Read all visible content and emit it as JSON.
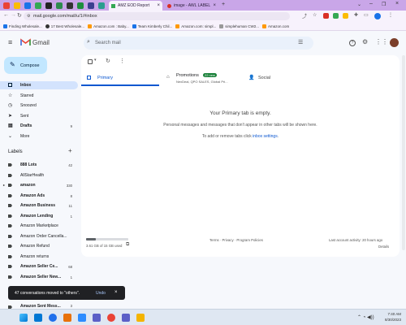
{
  "browser": {
    "tabs": [
      {
        "label": "AMZ EOD Report"
      },
      {
        "label": "image - AWL LABEL"
      }
    ],
    "address": "mail.google.com/mail/u/1/#inbox",
    "bookmarks": [
      {
        "label": "Finding Wholesale..."
      },
      {
        "label": "17 Best Wholesale..."
      },
      {
        "label": "Amazon.com : Baby..."
      },
      {
        "label": "Team Kimberly Chil..."
      },
      {
        "label": "Amazon.com: simpl..."
      },
      {
        "label": "simplehuman CW2..."
      },
      {
        "label": "Amazon.com"
      }
    ]
  },
  "gmail": {
    "logo_text": "Gmail",
    "search_placeholder": "Search mail",
    "compose_label": "Compose",
    "nav": [
      {
        "label": "Inbox",
        "count": ""
      },
      {
        "label": "Starred",
        "count": ""
      },
      {
        "label": "Snoozed",
        "count": ""
      },
      {
        "label": "Sent",
        "count": ""
      },
      {
        "label": "Drafts",
        "count": "9"
      },
      {
        "label": "More",
        "count": ""
      }
    ],
    "labels_heading": "Labels",
    "labels": [
      {
        "label": "888 Lots",
        "count": "42",
        "bold": true
      },
      {
        "label": "AllStarHealth",
        "count": "",
        "bold": false
      },
      {
        "label": "amazon",
        "count": "330",
        "bold": true
      },
      {
        "label": "Amazon Ads",
        "count": "8",
        "bold": true
      },
      {
        "label": "Amazon Business",
        "count": "11",
        "bold": true
      },
      {
        "label": "Amazon Lending",
        "count": "1",
        "bold": true
      },
      {
        "label": "Amazon Marketplace",
        "count": "",
        "bold": false
      },
      {
        "label": "Amazon Order Cancella...",
        "count": "",
        "bold": false
      },
      {
        "label": "Amazon Refund",
        "count": "",
        "bold": false
      },
      {
        "label": "Amazon returns",
        "count": "",
        "bold": false
      },
      {
        "label": "Amazon Seller Ce...",
        "count": "68",
        "bold": true
      },
      {
        "label": "Amazon Seller New...",
        "count": "1",
        "bold": true
      },
      {
        "label": "Amazon Sent Mess...",
        "count": "3",
        "bold": true
      }
    ],
    "tabs": {
      "primary": "Primary",
      "promotions": "Promotions",
      "promotions_badge": "22 new",
      "promotions_snippet": "NexDeal, QPO SALES, Global Pri...",
      "social": "Social"
    },
    "empty": {
      "title": "Your Primary tab is empty.",
      "line1": "Personal messages and messages that don't appear in other tabs will be shown here.",
      "line2_prefix": "To add or remove tabs click ",
      "line2_link": "inbox settings"
    },
    "footer": {
      "storage": "3.61 GB of 15 GB used",
      "storage_fraction": 0.24,
      "links": "Terms · Privacy · Program Policies",
      "activity": "Last account activity: 20 hours ago",
      "details": "Details"
    }
  },
  "snackbar": {
    "message": "47 conversations moved to \"others\".",
    "undo": "Undo"
  },
  "taskbar": {
    "time": "7:40 AM",
    "date": "8/30/2023"
  },
  "colors": {
    "tabstrip": "#c9a6e8",
    "compose": "#c2e7ff",
    "inbox_active": "#d3e3fd",
    "primary_blue": "#0b57d0",
    "badge_green": "#188038"
  }
}
